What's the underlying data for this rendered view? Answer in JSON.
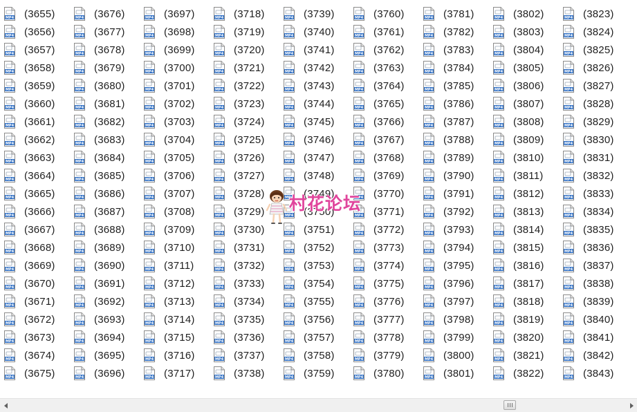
{
  "file_view": {
    "columns": [
      [
        "(3655)",
        "(3656)",
        "(3657)",
        "(3658)",
        "(3659)",
        "(3660)",
        "(3661)",
        "(3662)",
        "(3663)",
        "(3664)",
        "(3665)",
        "(3666)",
        "(3667)",
        "(3668)",
        "(3669)",
        "(3670)",
        "(3671)",
        "(3672)",
        "(3673)",
        "(3674)",
        "(3675)"
      ],
      [
        "(3676)",
        "(3677)",
        "(3678)",
        "(3679)",
        "(3680)",
        "(3681)",
        "(3682)",
        "(3683)",
        "(3684)",
        "(3685)",
        "(3686)",
        "(3687)",
        "(3688)",
        "(3689)",
        "(3690)",
        "(3691)",
        "(3692)",
        "(3693)",
        "(3694)",
        "(3695)",
        "(3696)"
      ],
      [
        "(3697)",
        "(3698)",
        "(3699)",
        "(3700)",
        "(3701)",
        "(3702)",
        "(3703)",
        "(3704)",
        "(3705)",
        "(3706)",
        "(3707)",
        "(3708)",
        "(3709)",
        "(3710)",
        "(3711)",
        "(3712)",
        "(3713)",
        "(3714)",
        "(3715)",
        "(3716)",
        "(3717)"
      ],
      [
        "(3718)",
        "(3719)",
        "(3720)",
        "(3721)",
        "(3722)",
        "(3723)",
        "(3724)",
        "(3725)",
        "(3726)",
        "(3727)",
        "(3728)",
        "(3729)",
        "(3730)",
        "(3731)",
        "(3732)",
        "(3733)",
        "(3734)",
        "(3735)",
        "(3736)",
        "(3737)",
        "(3738)"
      ],
      [
        "(3739)",
        "(3740)",
        "(3741)",
        "(3742)",
        "(3743)",
        "(3744)",
        "(3745)",
        "(3746)",
        "(3747)",
        "(3748)",
        "(3749)",
        "(3750)",
        "(3751)",
        "(3752)",
        "(3753)",
        "(3754)",
        "(3755)",
        "(3756)",
        "(3757)",
        "(3758)",
        "(3759)"
      ],
      [
        "(3760)",
        "(3761)",
        "(3762)",
        "(3763)",
        "(3764)",
        "(3765)",
        "(3766)",
        "(3767)",
        "(3768)",
        "(3769)",
        "(3770)",
        "(3771)",
        "(3772)",
        "(3773)",
        "(3774)",
        "(3775)",
        "(3776)",
        "(3777)",
        "(3778)",
        "(3779)",
        "(3780)"
      ],
      [
        "(3781)",
        "(3782)",
        "(3783)",
        "(3784)",
        "(3785)",
        "(3786)",
        "(3787)",
        "(3788)",
        "(3789)",
        "(3790)",
        "(3791)",
        "(3792)",
        "(3793)",
        "(3794)",
        "(3795)",
        "(3796)",
        "(3797)",
        "(3798)",
        "(3799)",
        "(3800)",
        "(3801)"
      ],
      [
        "(3802)",
        "(3803)",
        "(3804)",
        "(3805)",
        "(3806)",
        "(3807)",
        "(3808)",
        "(3809)",
        "(3810)",
        "(3811)",
        "(3812)",
        "(3813)",
        "(3814)",
        "(3815)",
        "(3816)",
        "(3817)",
        "(3818)",
        "(3819)",
        "(3820)",
        "(3821)",
        "(3822)"
      ],
      [
        "(3823)",
        "(3824)",
        "(3825)",
        "(3826)",
        "(3827)",
        "(3828)",
        "(3829)",
        "(3830)",
        "(3831)",
        "(3832)",
        "(3833)",
        "(3834)",
        "(3835)",
        "(3836)",
        "(3837)",
        "(3838)",
        "(3839)",
        "(3840)",
        "(3841)",
        "(3842)",
        "(3843)"
      ]
    ],
    "file_icon": "mp4-file-icon",
    "icon_label": "MP4",
    "icon_accent": "#2f6fc4"
  },
  "watermark": {
    "text": "村花论坛",
    "color": "#e0459c"
  },
  "scrollbar": {
    "left_arrow": "◀",
    "right_arrow": "▶",
    "position_fraction": 0.81
  }
}
